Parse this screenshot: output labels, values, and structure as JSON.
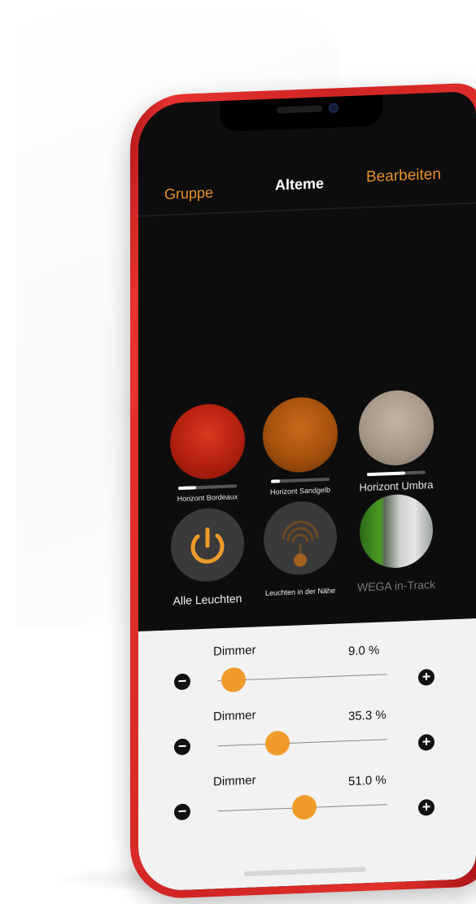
{
  "header": {
    "left_action": "Gruppe",
    "title": "Alteme",
    "right_action": "Bearbeiten"
  },
  "colors": {
    "accent": "#e8912d",
    "screen_bg": "#0d0d0d",
    "slider_knob": "#ef9a2b",
    "phone_red": "#d62c2a"
  },
  "materials": [
    {
      "label": "Horizont Bordeaux",
      "level": 0.3,
      "swatch": "#b3200f"
    },
    {
      "label": "Horizont Sandgelb",
      "level": 0.15,
      "swatch": "#a4510d"
    },
    {
      "label": "Horizont Umbra",
      "level": 0.65,
      "swatch": "#a7998a"
    }
  ],
  "actions": [
    {
      "label": "Alle Leuchten",
      "icon": "power-icon"
    },
    {
      "label": "Leuchten in der Nähe",
      "icon": "proximity-signal-icon"
    },
    {
      "label": "WEGA in-Track",
      "icon": "room-photo"
    }
  ],
  "sliders": [
    {
      "name": "Dimmer",
      "value_text": "9.0 %",
      "value": 9.0
    },
    {
      "name": "Dimmer",
      "value_text": "35.3 %",
      "value": 35.3
    },
    {
      "name": "Dimmer",
      "value_text": "51.0 %",
      "value": 51.0
    }
  ],
  "slider_buttons": {
    "minus": "−",
    "plus": "+"
  }
}
